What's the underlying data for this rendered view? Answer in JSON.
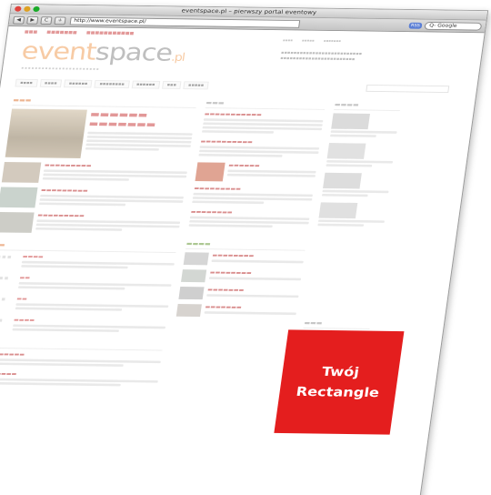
{
  "window": {
    "title": "eventspace.pl – pierwszy portal eventowy"
  },
  "toolbar": {
    "back": "◀",
    "forward": "▶",
    "reload": "C",
    "add": "+",
    "url": "http://www.eventspace.pl/",
    "rss": "RSS",
    "search_placeholder": "Q- Google"
  },
  "logo": {
    "event": "event",
    "space": "space",
    "pl": ".pl"
  },
  "ad": {
    "line1": "Twój",
    "line2": "Rectangle"
  }
}
